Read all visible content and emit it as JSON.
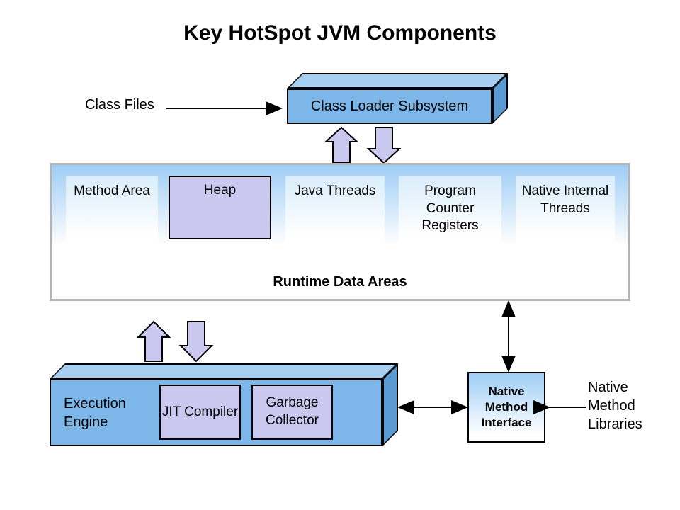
{
  "title": "Key HotSpot JVM Components",
  "classLoader": {
    "label": "Class Loader Subsystem"
  },
  "inputs": {
    "classFiles": "Class Files"
  },
  "runtimeDataAreas": {
    "label": "Runtime Data Areas",
    "cells": {
      "methodArea": "Method Area",
      "heap": "Heap",
      "javaThreads": "Java Threads",
      "programCounterRegisters": "Program Counter Registers",
      "nativeInternalThreads": "Native Internal Threads"
    }
  },
  "executionEngine": {
    "label": "Execution Engine",
    "jit": "JIT Compiler",
    "gc": "Garbage Collector"
  },
  "nativeMethodInterface": {
    "label": "Native Method Interface"
  },
  "nativeMethodLibraries": "Native Method Libraries"
}
